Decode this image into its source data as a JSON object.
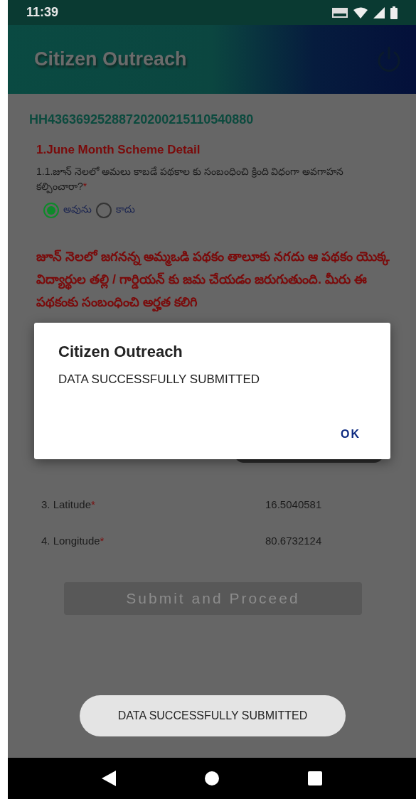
{
  "status_bar": {
    "time": "11:39"
  },
  "app_bar": {
    "title": "Citizen Outreach"
  },
  "form": {
    "household_id": "HH43636925288720200215110540880",
    "section_title": "1.June Month Scheme Detail",
    "question": {
      "text": "1.1.జూన్ నెలలో అమలు కాబడే పథకాల కు సంబంధించి క్రింది విధంగా అవగాహన కల్పించారా?",
      "required_mark": "*",
      "options": [
        {
          "label": "అవును",
          "selected": true
        },
        {
          "label": "కాదు",
          "selected": false
        }
      ]
    },
    "notice": "జూన్ నెలలో జగనన్న అమ్మఒడి పథకం తాలూకు నగదు ఆ పథకం యొక్క విద్యార్థుల తల్లి / గార్డియన్ కు జమ చేయడం జరుగుతుంది. మీరు ఈ పథకంకు సంబంధించి అర్హత కలిగి",
    "fields": [
      {
        "label": "3. Latitude",
        "required_mark": "*",
        "value": "16.5040581"
      },
      {
        "label": "4. Longitude",
        "required_mark": "*",
        "value": "80.6732124"
      }
    ],
    "submit_button": {
      "label": "Submit and Proceed",
      "disabled": true
    }
  },
  "dialog": {
    "title": "Citizen Outreach",
    "message": "DATA SUCCESSFULLY SUBMITTED",
    "button": "OK"
  },
  "toast": {
    "message": "DATA SUCCESSFULLY SUBMITTED"
  }
}
